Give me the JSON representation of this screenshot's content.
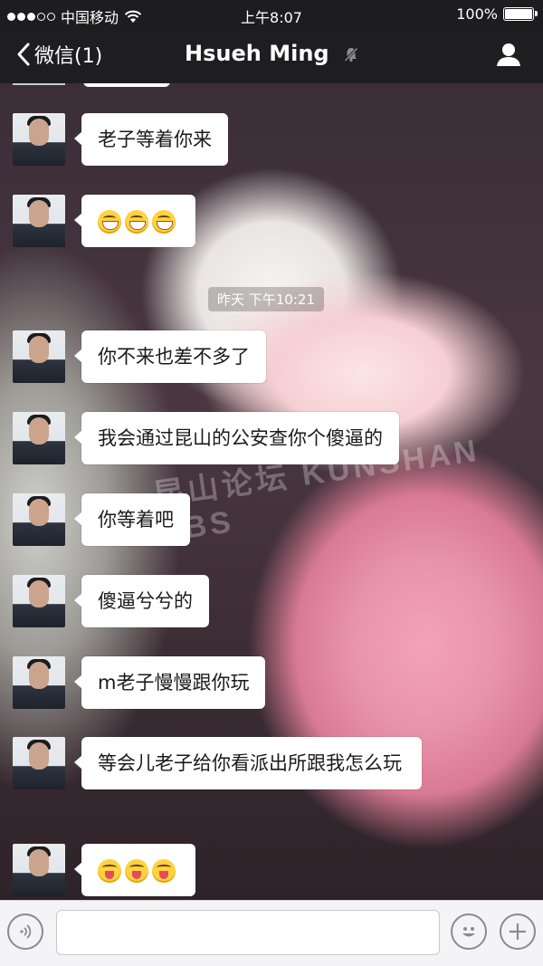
{
  "status_bar": {
    "carrier": "中国移动",
    "time": "上午8:07",
    "battery": "100%"
  },
  "nav": {
    "back_label": "微信(1)",
    "title": "Hsueh Ming"
  },
  "timestamp": "昨天 下午10:21",
  "watermark": "昆山论坛 KUNSHAN BBS",
  "messages": [
    {
      "text": "老子等着你来"
    },
    {
      "emojis": [
        "grin",
        "grin",
        "grin"
      ]
    },
    {
      "text": "你不来也差不多了"
    },
    {
      "text": "我会通过昆山的公安查你个傻逼的"
    },
    {
      "text": "你等着吧"
    },
    {
      "text": "傻逼兮兮的"
    },
    {
      "text": "m老子慢慢跟你玩"
    },
    {
      "text": "等会儿老子给你看派出所跟我怎么玩"
    },
    {
      "emojis": [
        "wink",
        "wink",
        "wink"
      ]
    }
  ],
  "input": {
    "placeholder": ""
  }
}
